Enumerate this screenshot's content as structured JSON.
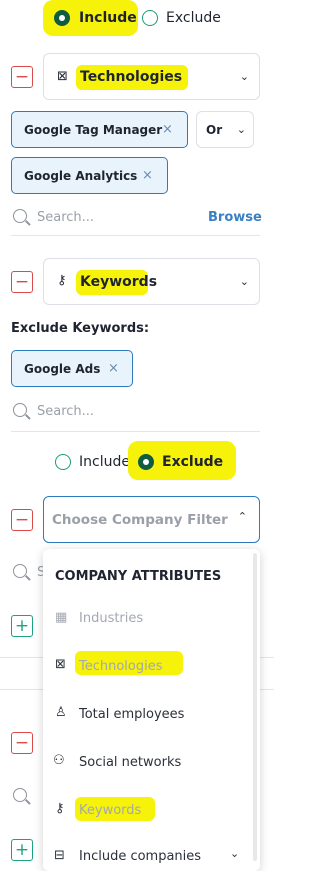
{
  "top_radio": {
    "include": "Include",
    "exclude": "Exclude",
    "selected": "include"
  },
  "technologies_filter": {
    "label": "Technologies",
    "chips": [
      "Google Tag Manager",
      "Google Analytics"
    ],
    "operator": "Or",
    "search_placeholder": "Search...",
    "browse": "Browse"
  },
  "keywords_filter": {
    "label": "Keywords",
    "exclude_heading": "Exclude Keywords:",
    "chips": [
      "Google Ads"
    ],
    "search_placeholder": "Search..."
  },
  "mid_radio": {
    "include": "Include",
    "exclude": "Exclude",
    "selected": "exclude"
  },
  "company_filter": {
    "placeholder": "Choose Company Filter",
    "partial_search": "S"
  },
  "dropdown": {
    "heading": "COMPANY ATTRIBUTES",
    "items": [
      {
        "label": "Industries",
        "icon": "building-icon",
        "disabled": true
      },
      {
        "label": "Technologies",
        "icon": "chip-icon",
        "disabled": true
      },
      {
        "label": "Total employees",
        "icon": "person-icon",
        "disabled": false
      },
      {
        "label": "Social networks",
        "icon": "people-icon",
        "disabled": false
      },
      {
        "label": "Keywords",
        "icon": "key-icon",
        "disabled": true
      },
      {
        "label": "Include companies",
        "icon": "building-list-icon",
        "disabled": false
      }
    ]
  },
  "colors": {
    "highlight": "#f6f20a",
    "accent_green": "#115c40",
    "minus_red": "#d94a4a",
    "plus_green": "#19a37f",
    "chip_blue": "#2c7bbf",
    "browse_blue": "#3a7fc1"
  }
}
